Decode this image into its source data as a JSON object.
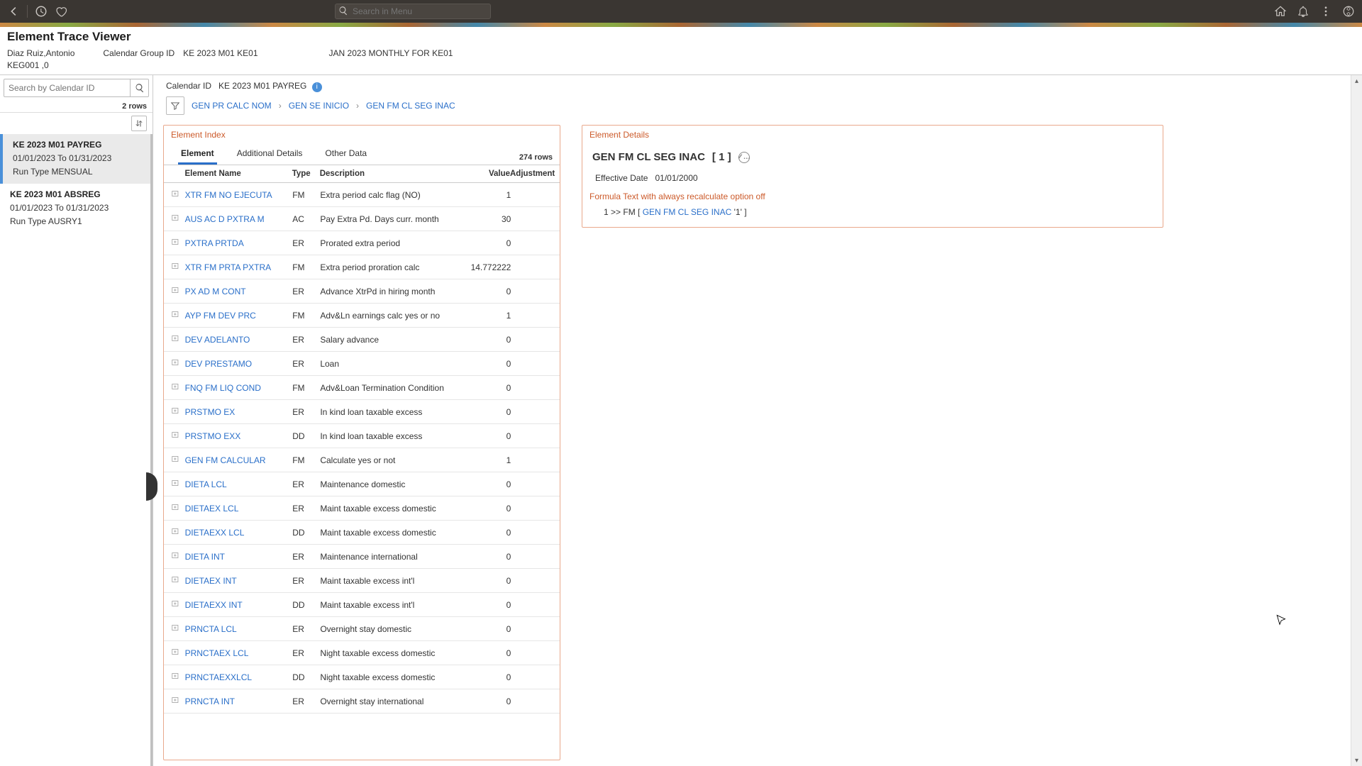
{
  "app": {
    "search_placeholder": "Search in Menu",
    "page_title": "Element Trace Viewer"
  },
  "header": {
    "employee": "Diaz Ruiz,Antonio",
    "employee_sub": "KEG001 ,0",
    "cal_group_label": "Calendar Group ID",
    "cal_group_id": "KE 2023 M01 KE01",
    "cal_group_desc": "JAN 2023 MONTHLY FOR KE01"
  },
  "left": {
    "search_placeholder": "Search by Calendar ID",
    "rows": "2 rows",
    "items": [
      {
        "name": "KE 2023 M01 PAYREG",
        "range": "01/01/2023   To   01/31/2023",
        "run": "Run Type   MENSUAL",
        "active": true
      },
      {
        "name": "KE 2023 M01 ABSREG",
        "range": "01/01/2023   To   01/31/2023",
        "run": "Run Type   AUSRY1",
        "active": false
      }
    ]
  },
  "main": {
    "cal_id_label": "Calendar ID",
    "cal_id": "KE 2023 M01 PAYREG",
    "crumbs": [
      "GEN PR CALC NOM",
      "GEN SE INICIO",
      "GEN FM CL SEG INAC"
    ]
  },
  "element_index": {
    "title": "Element Index",
    "tabs": [
      "Element",
      "Additional Details",
      "Other Data"
    ],
    "rowcount": "274 rows",
    "columns": {
      "name": "Element Name",
      "type": "Type",
      "desc": "Description",
      "value": "Value",
      "adj": "Adjustment"
    },
    "rows": [
      {
        "name": "XTR FM NO EJECUTA",
        "type": "FM",
        "desc": "Extra period calc flag (NO)",
        "value": "1",
        "adj": ""
      },
      {
        "name": "AUS AC D PXTRA M",
        "type": "AC",
        "desc": "Pay Extra Pd. Days curr. month",
        "value": "30",
        "adj": ""
      },
      {
        "name": "PXTRA PRTDA",
        "type": "ER",
        "desc": "Prorated extra period",
        "value": "0",
        "adj": ""
      },
      {
        "name": "XTR FM PRTA PXTRA",
        "type": "FM",
        "desc": "Extra period proration calc",
        "value": "14.772222",
        "adj": ""
      },
      {
        "name": "PX AD M CONT",
        "type": "ER",
        "desc": "Advance XtrPd in hiring month",
        "value": "0",
        "adj": ""
      },
      {
        "name": "AYP FM DEV PRC",
        "type": "FM",
        "desc": "Adv&Ln earnings calc yes or no",
        "value": "1",
        "adj": ""
      },
      {
        "name": "DEV ADELANTO",
        "type": "ER",
        "desc": "Salary advance",
        "value": "0",
        "adj": ""
      },
      {
        "name": "DEV PRESTAMO",
        "type": "ER",
        "desc": "Loan",
        "value": "0",
        "adj": ""
      },
      {
        "name": "FNQ FM LIQ COND",
        "type": "FM",
        "desc": "Adv&Loan Termination Condition",
        "value": "0",
        "adj": ""
      },
      {
        "name": "PRSTMO EX",
        "type": "ER",
        "desc": "In kind loan taxable excess",
        "value": "0",
        "adj": ""
      },
      {
        "name": "PRSTMO EXX",
        "type": "DD",
        "desc": "In kind loan taxable excess",
        "value": "0",
        "adj": ""
      },
      {
        "name": "GEN FM CALCULAR",
        "type": "FM",
        "desc": "Calculate yes or not",
        "value": "1",
        "adj": ""
      },
      {
        "name": "DIETA LCL",
        "type": "ER",
        "desc": "Maintenance domestic",
        "value": "0",
        "adj": ""
      },
      {
        "name": "DIETAEX LCL",
        "type": "ER",
        "desc": "Maint taxable excess domestic",
        "value": "0",
        "adj": ""
      },
      {
        "name": "DIETAEXX LCL",
        "type": "DD",
        "desc": "Maint taxable excess domestic",
        "value": "0",
        "adj": ""
      },
      {
        "name": "DIETA INT",
        "type": "ER",
        "desc": "Maintenance international",
        "value": "0",
        "adj": ""
      },
      {
        "name": "DIETAEX INT",
        "type": "ER",
        "desc": "Maint taxable excess int'l",
        "value": "0",
        "adj": ""
      },
      {
        "name": "DIETAEXX INT",
        "type": "DD",
        "desc": "Maint taxable excess int'l",
        "value": "0",
        "adj": ""
      },
      {
        "name": "PRNCTA LCL",
        "type": "ER",
        "desc": "Overnight stay domestic",
        "value": "0",
        "adj": ""
      },
      {
        "name": "PRNCTAEX LCL",
        "type": "ER",
        "desc": "Night taxable excess domestic",
        "value": "0",
        "adj": ""
      },
      {
        "name": "PRNCTAEXXLCL",
        "type": "DD",
        "desc": "Night taxable excess domestic",
        "value": "0",
        "adj": ""
      },
      {
        "name": "PRNCTA INT",
        "type": "ER",
        "desc": "Overnight stay international",
        "value": "0",
        "adj": ""
      }
    ]
  },
  "details": {
    "title": "Element Details",
    "name": "GEN FM CL SEG INAC",
    "result": "[ 1 ]",
    "eff_date_label": "Effective Date",
    "eff_date": "01/01/2000",
    "formula_title": "Formula Text with always recalculate option off",
    "formula_prefix": "1 >> FM [ ",
    "formula_link": "GEN FM CL SEG INAC",
    "formula_suffix": "  '1' ]"
  }
}
